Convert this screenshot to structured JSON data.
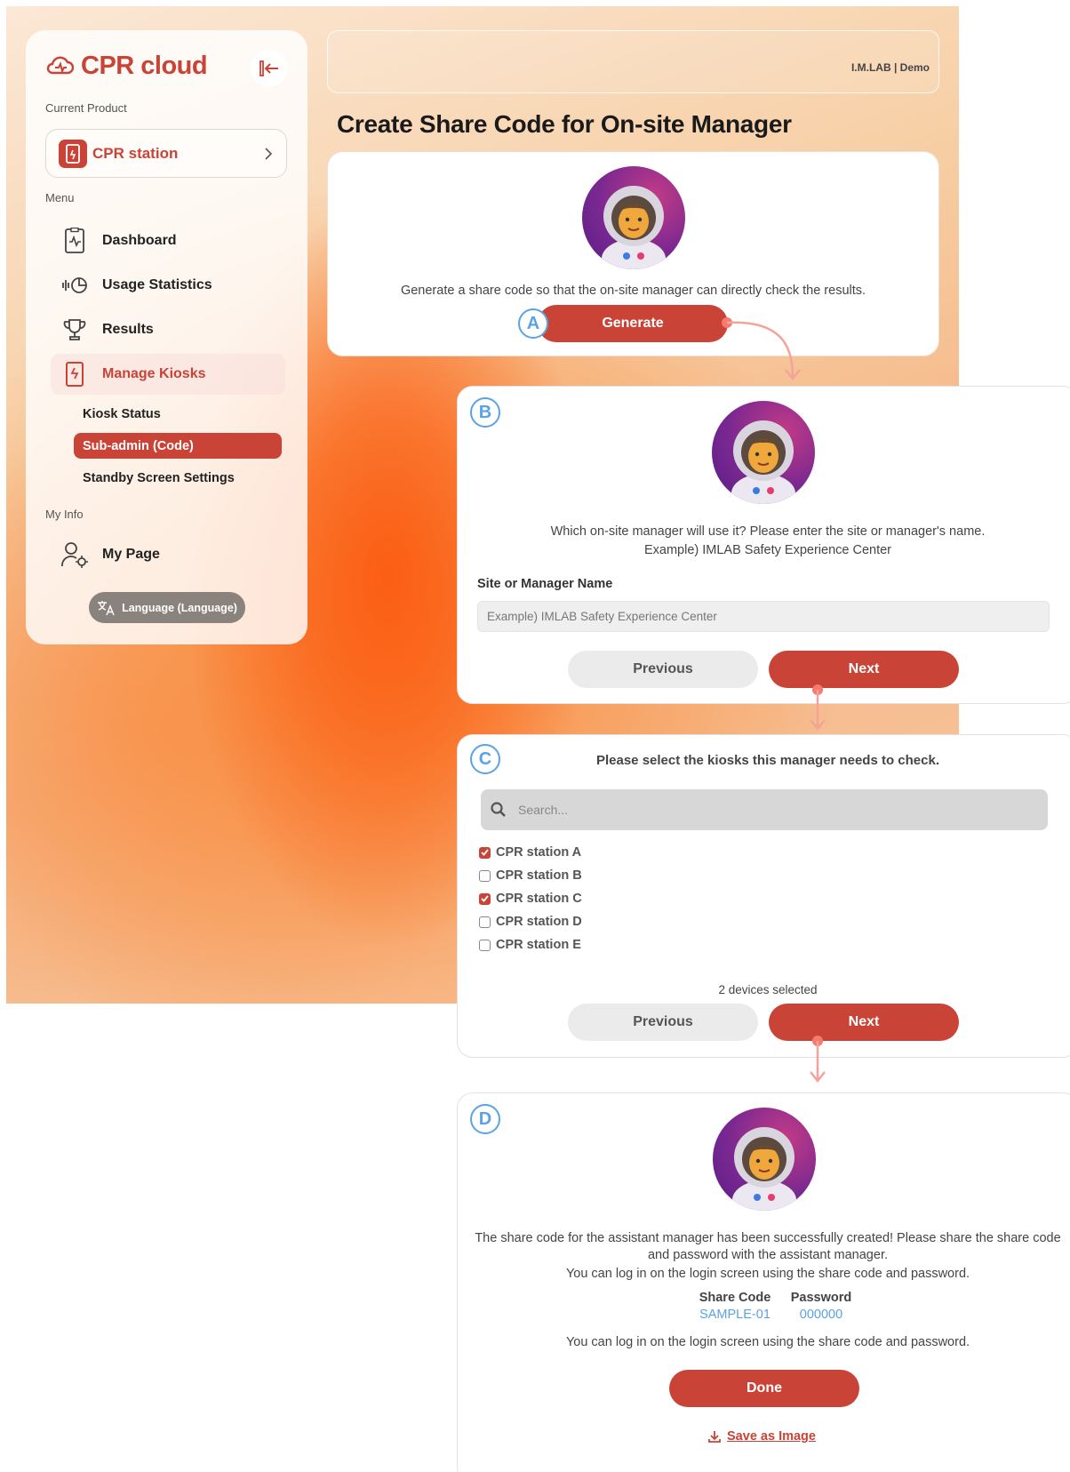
{
  "colors": {
    "accent": "#c94437",
    "step_badge": "#5aa3e6",
    "connector": "#f4a39b"
  },
  "sidebar": {
    "brand": "CPR cloud",
    "current_product_label": "Current Product",
    "product": "CPR station",
    "menu_label": "Menu",
    "items": [
      {
        "label": "Dashboard",
        "icon": "dashboard-icon"
      },
      {
        "label": "Usage Statistics",
        "icon": "usage-statistics-icon"
      },
      {
        "label": "Results",
        "icon": "trophy-icon"
      },
      {
        "label": "Manage Kiosks",
        "icon": "kiosk-icon",
        "active": true
      }
    ],
    "sub_items": [
      {
        "label": "Kiosk Status"
      },
      {
        "label": "Sub-admin (Code)",
        "active": true
      },
      {
        "label": "Standby Screen Settings"
      }
    ],
    "my_info_label": "My Info",
    "my_page": "My Page",
    "language_button": "Language (Language)"
  },
  "header": {
    "user": "I.M.LAB | Demo"
  },
  "page_title": "Create Share Code for On-site Manager",
  "step_a": {
    "badge": "A",
    "description": "Generate a share code so that the on-site manager can directly check the results.",
    "generate_button": "Generate"
  },
  "step_b": {
    "badge": "B",
    "line1": "Which on-site manager will use it? Please enter the site or manager's name.",
    "line2": "Example) IMLAB Safety Experience Center",
    "field_label": "Site or Manager Name",
    "field_placeholder": "Example) IMLAB Safety Experience Center",
    "previous": "Previous",
    "next": "Next"
  },
  "step_c": {
    "badge": "C",
    "prompt": "Please select the kiosks this manager needs to check.",
    "search_placeholder": "Search...",
    "kiosks": [
      {
        "name": "CPR station A",
        "checked": true
      },
      {
        "name": "CPR station B",
        "checked": false
      },
      {
        "name": "CPR station C",
        "checked": true
      },
      {
        "name": "CPR station D",
        "checked": false
      },
      {
        "name": "CPR station E",
        "checked": false
      }
    ],
    "selected_count": "2 devices selected",
    "previous": "Previous",
    "next": "Next"
  },
  "step_d": {
    "badge": "D",
    "line1": "The share code for the assistant manager has been successfully created! Please share the share code",
    "line2": "and password with the assistant manager.",
    "line3": "You can log in on the login screen using the share code and password.",
    "share_code_label": "Share Code",
    "share_code": "SAMPLE-01",
    "password_label": "Password",
    "password": "000000",
    "footnote": "You can log in on the login screen using the share code and password.",
    "done": "Done",
    "save_image": "Save as Image"
  }
}
